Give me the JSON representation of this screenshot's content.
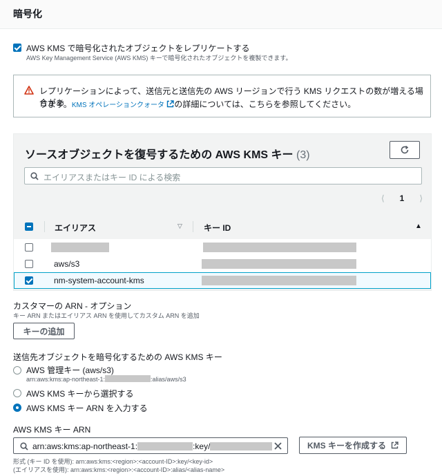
{
  "section": {
    "title": "暗号化"
  },
  "replicate": {
    "checked": true,
    "label": "AWS KMS で暗号化されたオブジェクトをレプリケートする",
    "description": "AWS Key Management Service (AWS KMS) キーで暗号化されたオブジェクトを複製できます。"
  },
  "alert": {
    "line1": "レプリケーションによって、送信元と送信先の AWS リージョンで行う KMS リクエストの数が増える場合があ",
    "line2_prefix": "ります。",
    "link": "KMS オペレーションクォータ",
    "line2_suffix": "の詳細については、こちらを参照してください。"
  },
  "source_keys": {
    "title": "ソースオブジェクトを復号するための AWS KMS キー",
    "count": "(3)",
    "search_placeholder": "エイリアスまたはキー ID による検索",
    "page": "1",
    "columns": {
      "alias": "エイリアス",
      "key_id": "キー ID"
    },
    "rows": [
      {
        "alias": "",
        "checked": false
      },
      {
        "alias": "aws/s3",
        "checked": false
      },
      {
        "alias": "nm-system-account-kms",
        "checked": true
      }
    ]
  },
  "customer_arn": {
    "label": "カスタマーの ARN - オプション",
    "hint": "キー ARN またはエイリアス ARN を使用してカスタム ARN を追加",
    "button": "キーの追加"
  },
  "dest_key": {
    "label": "送信先オブジェクトを暗号化するための AWS KMS キー",
    "options": [
      {
        "label": "AWS 管理キー (aws/s3)",
        "sub_prefix": "arn:aws:kms:ap-northeast-1:",
        "sub_suffix": ":alias/aws/s3",
        "selected": false
      },
      {
        "label": "AWS KMS キーから選択する",
        "selected": false
      },
      {
        "label": "AWS KMS キー ARN を入力する",
        "selected": true
      }
    ]
  },
  "kms_arn": {
    "label": "AWS KMS キー ARN",
    "value_prefix": "arn:aws:kms:ap-northeast-1:",
    "value_mid": ":key/",
    "create_button": "KMS キーを作成する",
    "format1": "形式 (キー ID を使用): arn:aws:kms:<region>:<account-ID>:key/<key-id>",
    "format2": "(エイリアスを使用): arn:aws:kms:<region>:<account-ID>:alias/<alias-name>"
  },
  "colors": {
    "accent": "#0073bb",
    "warning": "#d13212"
  }
}
